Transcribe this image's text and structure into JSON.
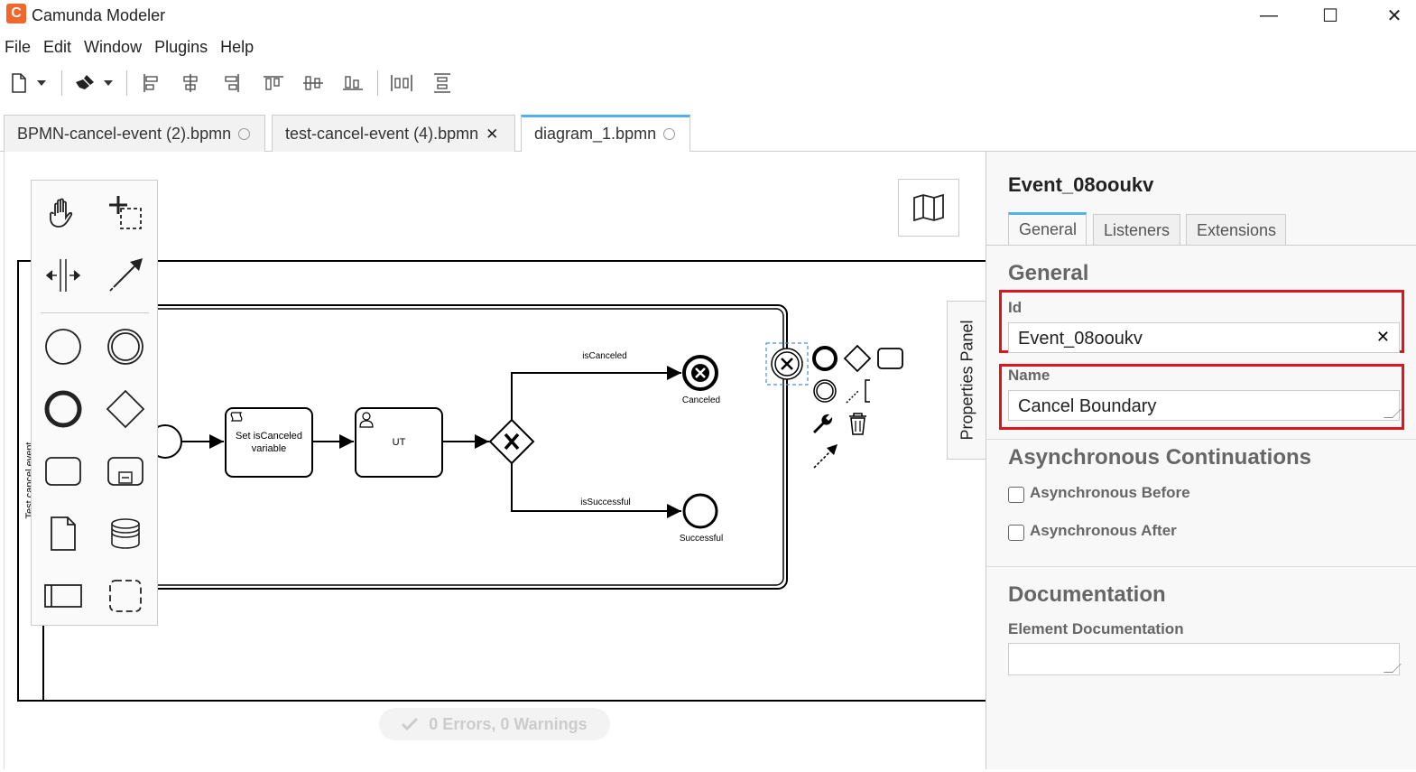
{
  "window": {
    "title": "Camunda Modeler",
    "logo_glyph": "C",
    "controls": {
      "minimize": "—",
      "maximize": "☐",
      "close": "✕"
    }
  },
  "menu": [
    "File",
    "Edit",
    "Window",
    "Plugins",
    "Help"
  ],
  "toolbar": {
    "icons": [
      "new-file-icon",
      "chevron-down-icon",
      "brush-icon",
      "chevron-down-icon",
      "align-left-icon",
      "align-center-icon",
      "align-right-icon",
      "align-top-icon",
      "align-middle-icon",
      "align-bottom-icon",
      "distribute-horizontal-icon",
      "distribute-vertical-icon"
    ]
  },
  "tabs": [
    {
      "label": "BPMN-cancel-event (2).bpmn",
      "mark": "circle",
      "active": false
    },
    {
      "label": "test-cancel-event (4).bpmn",
      "mark": "✕",
      "active": false
    },
    {
      "label": "diagram_1.bpmn",
      "mark": "circle",
      "active": true
    }
  ],
  "diagram": {
    "pool_label": "Test cancel event",
    "tasks": [
      {
        "label_line1": "Set isCanceled",
        "label_line2": "variable",
        "type": "script-task"
      },
      {
        "label_line1": "UT",
        "label_line2": "",
        "type": "user-task"
      }
    ],
    "flows": {
      "upper": "isCanceled",
      "lower": "isSuccessful"
    },
    "end_events": {
      "canceled": "Canceled",
      "successful": "Successful"
    },
    "gateway_type": "exclusive",
    "selected_element": "cancel-boundary-event"
  },
  "status": {
    "text": "0 Errors, 0 Warnings",
    "icon": "check-icon"
  },
  "properties_toggle": "Properties Panel",
  "properties": {
    "title": "Event_08ooukv",
    "tabs": [
      "General",
      "Listeners",
      "Extensions"
    ],
    "active_tab": "General",
    "section_general": "General",
    "id_label": "Id",
    "id_value": "Event_08ooukv",
    "clear_glyph": "✕",
    "name_label": "Name",
    "name_value": "Cancel Boundary",
    "section_async": "Asynchronous Continuations",
    "async_before": "Asynchronous Before",
    "async_after": "Asynchronous After",
    "section_docs": "Documentation",
    "doc_label": "Element Documentation",
    "doc_value": ""
  },
  "colors": {
    "accent": "#52b0ec",
    "highlight": "#e0141e",
    "logo": "#f1662b",
    "selection": "#4a90d9"
  }
}
